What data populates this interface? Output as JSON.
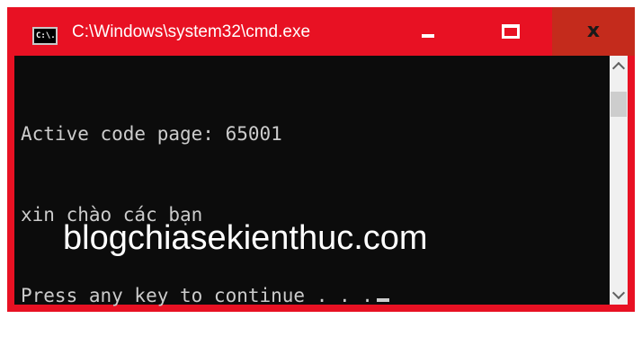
{
  "window": {
    "title": "C:\\Windows\\system32\\cmd.exe",
    "icon_label": "C:\\.",
    "accent_color": "#e81123"
  },
  "controls": {
    "minimize_icon": "minimize-icon",
    "maximize_icon": "maximize-icon",
    "close_label": "x"
  },
  "console": {
    "lines": [
      "Active code page: 65001",
      "xin chào các bạn",
      "Press any key to continue . . ."
    ],
    "background": "#0c0c0c",
    "text_color": "#cccccc"
  },
  "watermark": "blogchiasekienthuc.com"
}
